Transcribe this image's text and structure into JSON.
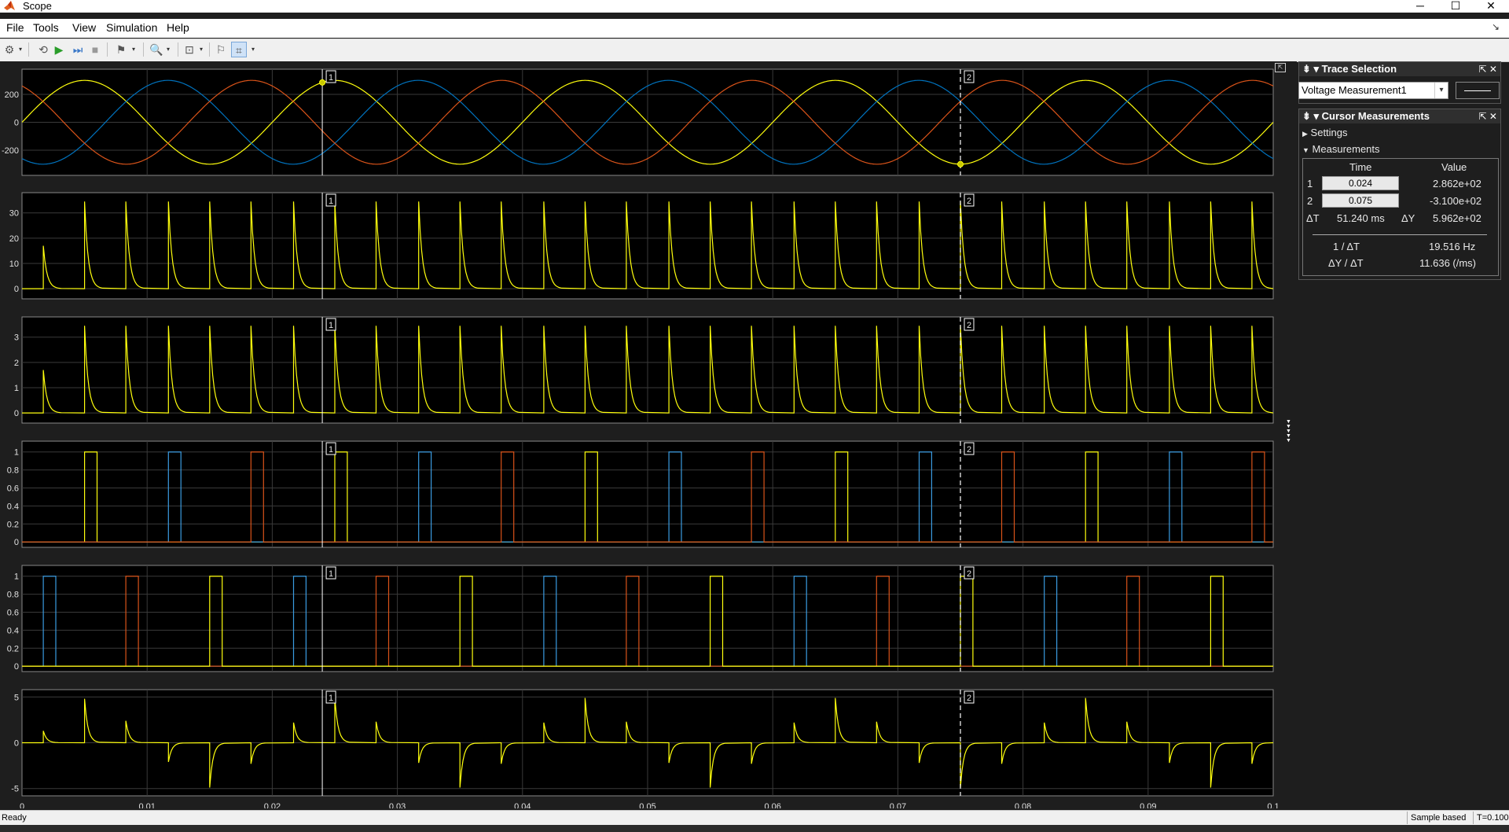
{
  "window": {
    "title": "Scope",
    "minimize": "─",
    "maximize": "☐",
    "close": "✕"
  },
  "menu": [
    {
      "label": "File"
    },
    {
      "label": "Tools"
    },
    {
      "label": "View"
    },
    {
      "label": "Simulation"
    },
    {
      "label": "Help"
    }
  ],
  "toolbar": {
    "icons": [
      "settings-icon",
      "restore-icon",
      "run-icon",
      "step-forward-icon",
      "stop-icon",
      "highlight-block-icon",
      "zoom-in-icon",
      "scale-axes-icon",
      "triggers-icon",
      "cursor-measurements-icon"
    ]
  },
  "colors": {
    "background": "#1e1e1e",
    "axes_bg": "#000000",
    "grid": "#3a3a3a",
    "axis_text": "#e0e0e0",
    "yellow": "#ffff0d",
    "blue": "#0072bd",
    "blue_bright": "#3a9be0",
    "orange": "#d95319"
  },
  "cursors": {
    "c1_label": "1",
    "c2_label": "2",
    "c1_time": 0.024,
    "c2_time": 0.075
  },
  "x_axis": {
    "ticks": [
      "0",
      "0.01",
      "0.02",
      "0.03",
      "0.04",
      "0.05",
      "0.06",
      "0.07",
      "0.08",
      "0.09",
      "0.1"
    ],
    "xlim": [
      0,
      0.1
    ]
  },
  "chart_data": [
    {
      "type": "line",
      "title": "",
      "xlabel": "",
      "ylabel": "",
      "xlim": [
        0,
        0.1
      ],
      "ylim": [
        -380,
        380
      ],
      "yticks": [
        "200",
        "0",
        "-200"
      ],
      "ytick_values": [
        200,
        0,
        -200
      ],
      "grid": true,
      "series": [
        {
          "color": "yellow",
          "kind": "sine",
          "amplitude": 300,
          "freq_hz": 50,
          "phase_deg": 0
        },
        {
          "color": "blue",
          "kind": "sine",
          "amplitude": 300,
          "freq_hz": 50,
          "phase_deg": -120
        },
        {
          "color": "orange",
          "kind": "sine",
          "amplitude": 300,
          "freq_hz": 50,
          "phase_deg": 120
        }
      ]
    },
    {
      "type": "line",
      "title": "",
      "xlabel": "",
      "ylabel": "",
      "xlim": [
        0,
        0.1
      ],
      "ylim": [
        -4,
        38
      ],
      "yticks": [
        "30",
        "20",
        "10",
        "0"
      ],
      "ytick_values": [
        30,
        20,
        10,
        0
      ],
      "grid": true,
      "series": [
        {
          "color": "yellow",
          "kind": "spikes",
          "peak": 34.5,
          "first_peak": 17,
          "spike_times": [
            0.0017,
            0.005,
            0.0083,
            0.0117,
            0.015,
            0.0183,
            0.0217,
            0.025,
            0.0283,
            0.0317,
            0.035,
            0.0383,
            0.0417,
            0.045,
            0.0483,
            0.0517,
            0.055,
            0.0583,
            0.0617,
            0.065,
            0.0683,
            0.0717,
            0.075,
            0.0783,
            0.0817,
            0.085,
            0.0883,
            0.0917,
            0.095,
            0.0983
          ]
        }
      ]
    },
    {
      "type": "line",
      "title": "",
      "xlabel": "",
      "ylabel": "",
      "xlim": [
        0,
        0.1
      ],
      "ylim": [
        -0.4,
        3.8
      ],
      "yticks": [
        "3",
        "2",
        "1",
        "0"
      ],
      "ytick_values": [
        3,
        2,
        1,
        0
      ],
      "grid": true,
      "series": [
        {
          "color": "yellow",
          "kind": "spikes",
          "peak": 3.45,
          "first_peak": 1.7,
          "spike_times": [
            0.0017,
            0.005,
            0.0083,
            0.0117,
            0.015,
            0.0183,
            0.0217,
            0.025,
            0.0283,
            0.0317,
            0.035,
            0.0383,
            0.0417,
            0.045,
            0.0483,
            0.0517,
            0.055,
            0.0583,
            0.0617,
            0.065,
            0.0683,
            0.0717,
            0.075,
            0.0783,
            0.0817,
            0.085,
            0.0883,
            0.0917,
            0.095,
            0.0983
          ]
        }
      ]
    },
    {
      "type": "line",
      "title": "",
      "xlabel": "",
      "ylabel": "",
      "xlim": [
        0,
        0.1
      ],
      "ylim": [
        -0.06,
        1.12
      ],
      "yticks": [
        "1",
        "0.8",
        "0.6",
        "0.4",
        "0.2",
        "0"
      ],
      "ytick_values": [
        1,
        0.8,
        0.6,
        0.4,
        0.2,
        0
      ],
      "grid": true,
      "series": [
        {
          "color": "yellow",
          "kind": "pulses",
          "pulses": [
            [
              0.005,
              0.006
            ],
            [
              0.025,
              0.026
            ],
            [
              0.045,
              0.046
            ],
            [
              0.065,
              0.066
            ],
            [
              0.085,
              0.086
            ]
          ]
        },
        {
          "color": "blue_bright",
          "kind": "pulses",
          "pulses": [
            [
              0.0117,
              0.0127
            ],
            [
              0.0317,
              0.0327
            ],
            [
              0.0517,
              0.0527
            ],
            [
              0.0717,
              0.0727
            ],
            [
              0.0917,
              0.0927
            ]
          ]
        },
        {
          "color": "orange",
          "kind": "pulses",
          "pulses": [
            [
              0.0183,
              0.0193
            ],
            [
              0.0383,
              0.0393
            ],
            [
              0.0583,
              0.0593
            ],
            [
              0.0783,
              0.0793
            ],
            [
              0.0983,
              0.0993
            ]
          ]
        }
      ]
    },
    {
      "type": "line",
      "title": "",
      "xlabel": "",
      "ylabel": "",
      "xlim": [
        0,
        0.1
      ],
      "ylim": [
        -0.06,
        1.12
      ],
      "yticks": [
        "1",
        "0.8",
        "0.6",
        "0.4",
        "0.2",
        "0"
      ],
      "ytick_values": [
        1,
        0.8,
        0.6,
        0.4,
        0.2,
        0
      ],
      "grid": true,
      "series": [
        {
          "color": "blue_bright",
          "kind": "pulses",
          "pulses": [
            [
              0.0017,
              0.0027
            ],
            [
              0.0217,
              0.0227
            ],
            [
              0.0417,
              0.0427
            ],
            [
              0.0617,
              0.0627
            ],
            [
              0.0817,
              0.0827
            ]
          ]
        },
        {
          "color": "orange",
          "kind": "pulses",
          "pulses": [
            [
              0.0083,
              0.0093
            ],
            [
              0.0283,
              0.0293
            ],
            [
              0.0483,
              0.0493
            ],
            [
              0.0683,
              0.0693
            ],
            [
              0.0883,
              0.0893
            ]
          ]
        },
        {
          "color": "yellow",
          "kind": "pulses",
          "pulses": [
            [
              0.015,
              0.016
            ],
            [
              0.035,
              0.036
            ],
            [
              0.055,
              0.056
            ],
            [
              0.075,
              0.076
            ],
            [
              0.095,
              0.096
            ]
          ]
        }
      ]
    },
    {
      "type": "line",
      "title": "",
      "xlabel": "",
      "ylabel": "",
      "xlim": [
        0,
        0.1
      ],
      "ylim": [
        -5.8,
        5.8
      ],
      "yticks": [
        "5",
        "0",
        "-5"
      ],
      "ytick_values": [
        5,
        0,
        -5
      ],
      "grid": true,
      "series": [
        {
          "color": "yellow",
          "kind": "signed_spikes",
          "spikes": [
            [
              0.0017,
              1.3
            ],
            [
              0.005,
              4.8
            ],
            [
              0.0083,
              2.4
            ],
            [
              0.0117,
              -2.1
            ],
            [
              0.015,
              -4.9
            ],
            [
              0.0183,
              -2.3
            ],
            [
              0.0217,
              2.2
            ],
            [
              0.025,
              4.9
            ],
            [
              0.0283,
              2.3
            ],
            [
              0.0317,
              -2.2
            ],
            [
              0.035,
              -4.9
            ],
            [
              0.0383,
              -2.3
            ],
            [
              0.0417,
              2.2
            ],
            [
              0.045,
              4.9
            ],
            [
              0.0483,
              2.3
            ],
            [
              0.0517,
              -2.2
            ],
            [
              0.055,
              -4.9
            ],
            [
              0.0583,
              -2.3
            ],
            [
              0.0617,
              2.2
            ],
            [
              0.065,
              4.9
            ],
            [
              0.0683,
              2.3
            ],
            [
              0.0717,
              -2.2
            ],
            [
              0.075,
              -4.9
            ],
            [
              0.0783,
              -2.3
            ],
            [
              0.0817,
              2.2
            ],
            [
              0.085,
              4.9
            ],
            [
              0.0883,
              2.3
            ],
            [
              0.0917,
              -2.2
            ],
            [
              0.095,
              -4.9
            ],
            [
              0.0983,
              -2.3
            ]
          ]
        }
      ]
    }
  ],
  "trace_selection": {
    "title": "Trace Selection",
    "selected": "Voltage Measurement1"
  },
  "cursor_measurements": {
    "title": "Cursor Measurements",
    "settings_label": "Settings",
    "measurements_label": "Measurements",
    "col_time": "Time",
    "col_value": "Value",
    "row1_label": "1",
    "row1_time": "0.024",
    "row1_value": "2.862e+02",
    "row2_label": "2",
    "row2_time": "0.075",
    "row2_value": "-3.100e+02",
    "dt_label": "ΔT",
    "dt_value": "51.240 ms",
    "dy_label": "ΔY",
    "dy_value": "5.962e+02",
    "inv_dt_label": "1 / ΔT",
    "inv_dt_value": "19.516 Hz",
    "slope_label": "ΔY / ΔT",
    "slope_value": "11.636 (/ms)"
  },
  "status": {
    "ready": "Ready",
    "mode": "Sample based",
    "time": "T=0.100"
  }
}
